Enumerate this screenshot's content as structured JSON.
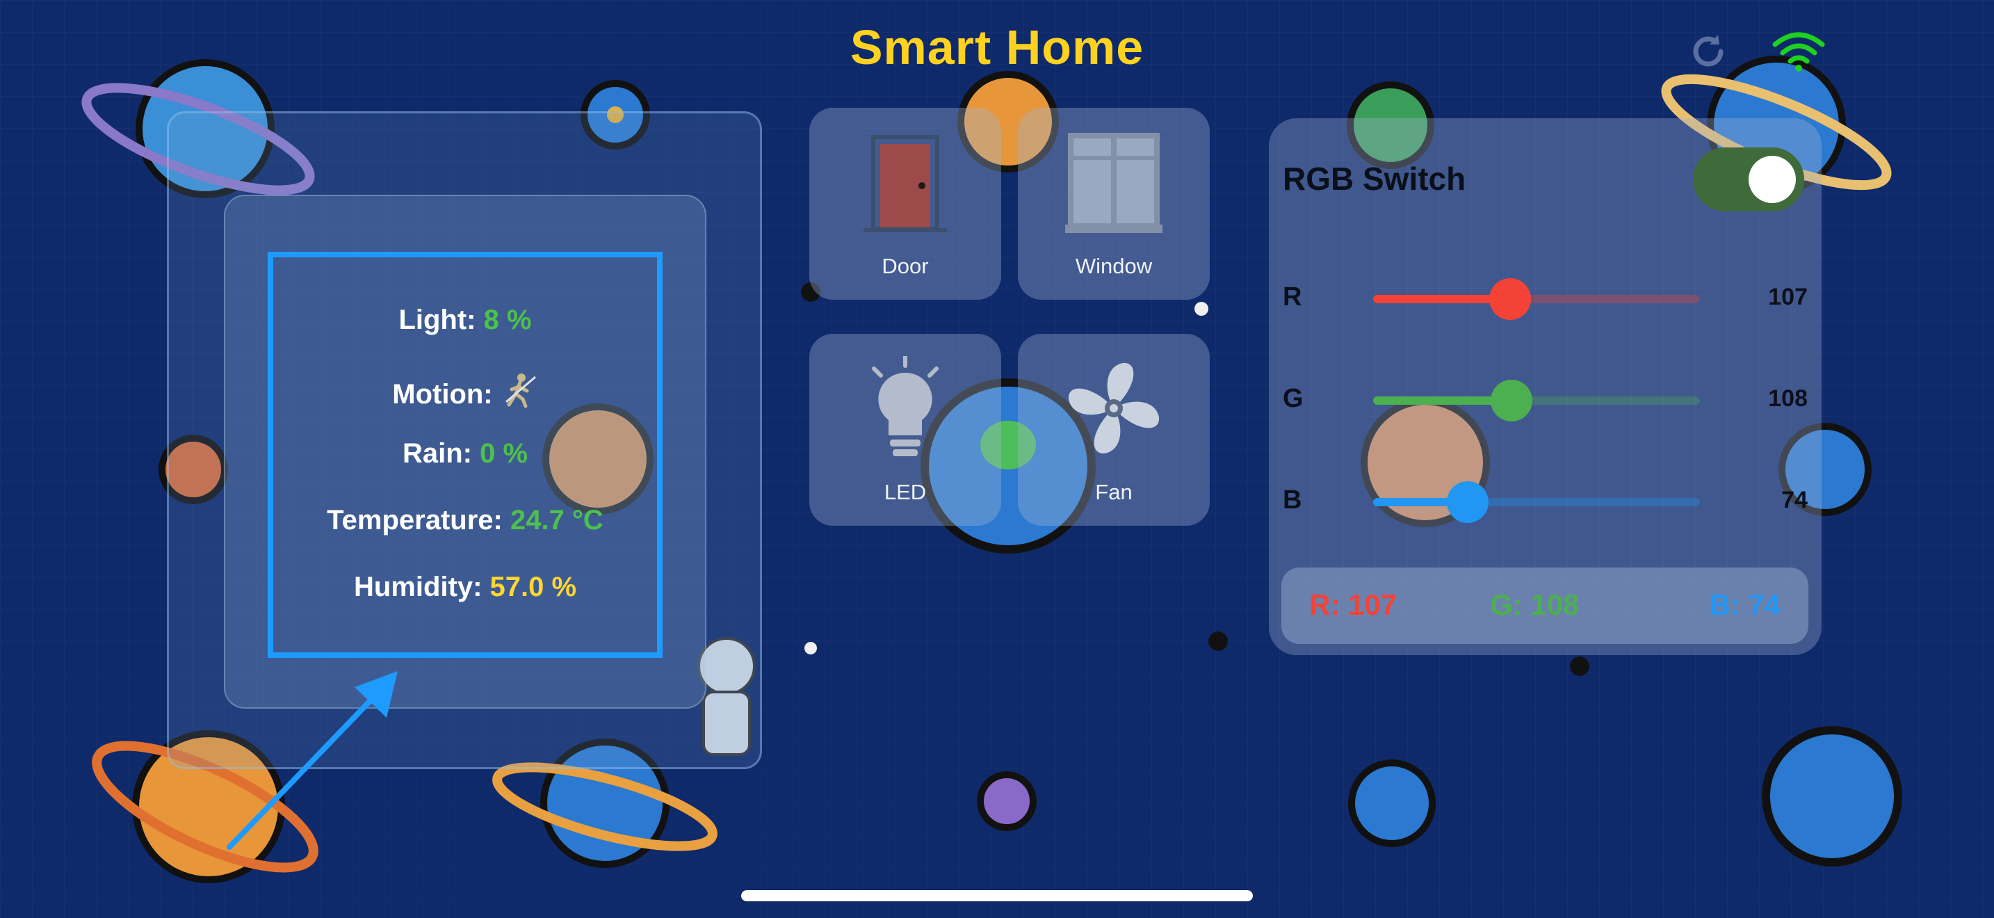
{
  "header": {
    "title": "Smart Home"
  },
  "status_icons": {
    "refresh": "refresh-icon",
    "wifi": "wifi-icon",
    "wifi_color": "#1fd21f"
  },
  "sensors": {
    "light": {
      "label": "Light:",
      "value": "8 %"
    },
    "motion": {
      "label": "Motion:",
      "icon": "walking-person-icon"
    },
    "rain": {
      "label": "Rain:",
      "value": "0 %"
    },
    "temperature": {
      "label": "Temperature:",
      "value": "24.7 °C"
    },
    "humidity": {
      "label": "Humidity:",
      "value": "57.0 %"
    }
  },
  "devices": [
    {
      "label": "Door",
      "icon": "door-icon"
    },
    {
      "label": "Window",
      "icon": "window-icon"
    },
    {
      "label": "LED",
      "icon": "lightbulb-icon"
    },
    {
      "label": "Fan",
      "icon": "fan-icon"
    }
  ],
  "rgb": {
    "title": "RGB Switch",
    "switch_on": true,
    "sliders": [
      {
        "label": "R",
        "value": 107,
        "max": 255,
        "display": "107",
        "color": "#f44336"
      },
      {
        "label": "G",
        "value": 108,
        "max": 255,
        "display": "108",
        "color": "#4caf50"
      },
      {
        "label": "B",
        "value": 74,
        "max": 255,
        "display": "74",
        "color": "#2196f3"
      }
    ],
    "readout": {
      "r": "R: 107",
      "g": "G: 108",
      "b": "B: 74"
    }
  },
  "colors": {
    "accent_title": "#ffd21f",
    "background": "#0f2a6b",
    "highlight_box": "#1e9bff"
  }
}
